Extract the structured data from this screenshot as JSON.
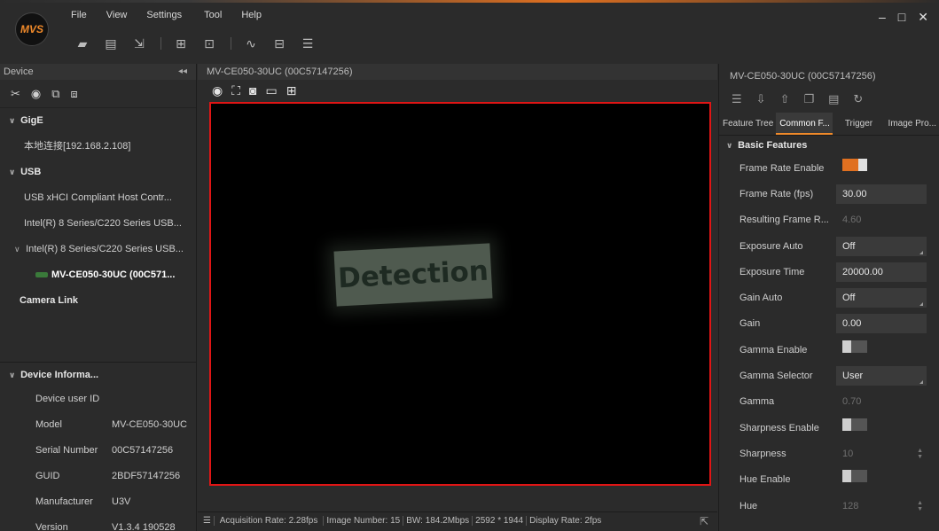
{
  "app": {
    "logo_text": "MVS"
  },
  "menu": {
    "items": [
      "File",
      "View",
      "Settings",
      "Tool",
      "Help"
    ]
  },
  "window_controls": {
    "minimize": "–",
    "maximize": "□",
    "close": "✕"
  },
  "left_panel": {
    "title": "Device",
    "collapse_glyph": "◂◂",
    "tree": {
      "gige": "GigE",
      "gige_child": "本地连接[192.168.2.108]",
      "usb": "USB",
      "usb_children": [
        "USB xHCI Compliant Host Contr...",
        "Intel(R) 8 Series/C220 Series USB..."
      ],
      "usb_expanded": "Intel(R) 8 Series/C220 Series USB...",
      "camera": "MV-CE050-30UC (00C571...",
      "camera_link": "Camera Link"
    },
    "device_info": {
      "title": "Device Informa...",
      "rows": [
        {
          "k": "Device user ID",
          "v": ""
        },
        {
          "k": "Model",
          "v": "MV-CE050-30UC"
        },
        {
          "k": "Serial Number",
          "v": "00C57147256"
        },
        {
          "k": "GUID",
          "v": "2BDF57147256"
        },
        {
          "k": "Manufacturer",
          "v": "U3V"
        },
        {
          "k": "Version",
          "v": "V1.3.4 190528"
        }
      ]
    }
  },
  "center": {
    "title": "MV-CE050-30UC (00C57147256)",
    "image_text": "Detection",
    "status": {
      "acq": "Acquisition Rate: 2.28fps",
      "img": "Image Number: 15",
      "bw": "BW: 184.2Mbps",
      "res": "2592 * 1944",
      "disp": "Display Rate: 2fps"
    }
  },
  "right_panel": {
    "title": "MV-CE050-30UC (00C57147256)",
    "tabs": [
      "Feature Tree",
      "Common F...",
      "Trigger",
      "Image Pro..."
    ],
    "section": "Basic Features",
    "props": [
      {
        "k": "Frame Rate Enable",
        "type": "toggle",
        "state": "on"
      },
      {
        "k": "Frame Rate (fps)",
        "type": "box",
        "v": "30.00"
      },
      {
        "k": "Resulting Frame R...",
        "type": "dim",
        "v": "4.60"
      },
      {
        "k": "Exposure Auto",
        "type": "dropdown",
        "v": "Off"
      },
      {
        "k": "Exposure Time",
        "type": "box",
        "v": "20000.00"
      },
      {
        "k": "Gain Auto",
        "type": "dropdown",
        "v": "Off"
      },
      {
        "k": "Gain",
        "type": "box",
        "v": "0.00"
      },
      {
        "k": "Gamma Enable",
        "type": "toggle",
        "state": "off"
      },
      {
        "k": "Gamma Selector",
        "type": "dropdown",
        "v": "User"
      },
      {
        "k": "Gamma",
        "type": "dim",
        "v": "0.70"
      },
      {
        "k": "Sharpness Enable",
        "type": "toggle",
        "state": "off"
      },
      {
        "k": "Sharpness",
        "type": "spin",
        "v": "10"
      },
      {
        "k": "Hue Enable",
        "type": "toggle",
        "state": "off"
      },
      {
        "k": "Hue",
        "type": "spin",
        "v": "128"
      }
    ]
  }
}
